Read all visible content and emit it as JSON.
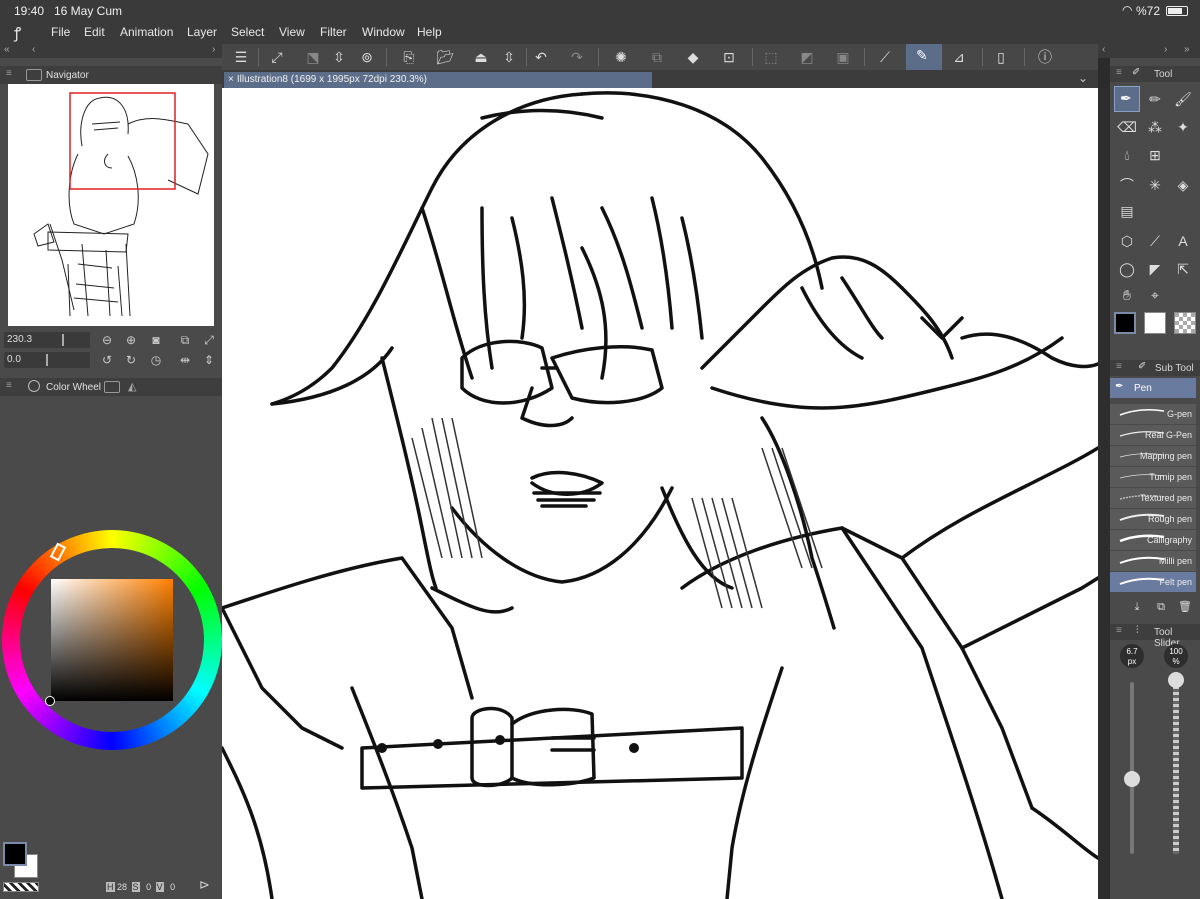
{
  "status": {
    "time": "19:40",
    "date": "16 May Cum",
    "battery": "%72"
  },
  "menu": [
    "File",
    "Edit",
    "Animation",
    "Layer",
    "Select",
    "View",
    "Filter",
    "Window",
    "Help"
  ],
  "navigator": {
    "title": "Navigator",
    "zoom": "230.3",
    "rotation": "0.0"
  },
  "color_panel": {
    "title": "Color Wheel"
  },
  "document": {
    "tab_label": "Illustration8 (1699 x 1995px 72dpi 230.3%)"
  },
  "tool_panel": {
    "title": "Tool"
  },
  "subtool_panel": {
    "title": "Sub Tool",
    "group": "Pen",
    "items": [
      "G-pen",
      "Real G-Pen",
      "Mapping pen",
      "Turnip pen",
      "Textured pen",
      "Rough pen",
      "Calligraphy",
      "Milli pen",
      "Felt pen"
    ],
    "selected": "Felt pen"
  },
  "tool_slider": {
    "title": "Tool Slider",
    "size_value": "6.7",
    "size_unit": "px",
    "opacity_value": "100",
    "opacity_unit": "%"
  },
  "bottom_status": {
    "h_label": "H",
    "h_value": "28",
    "s_label": "S",
    "s_value": "0",
    "v_label": "V",
    "v_value": "0"
  },
  "colors": {
    "accent": "#5c6d8a",
    "panel": "#4a4a4a",
    "main_color": "#000000",
    "sub_color": "#ffffff"
  }
}
